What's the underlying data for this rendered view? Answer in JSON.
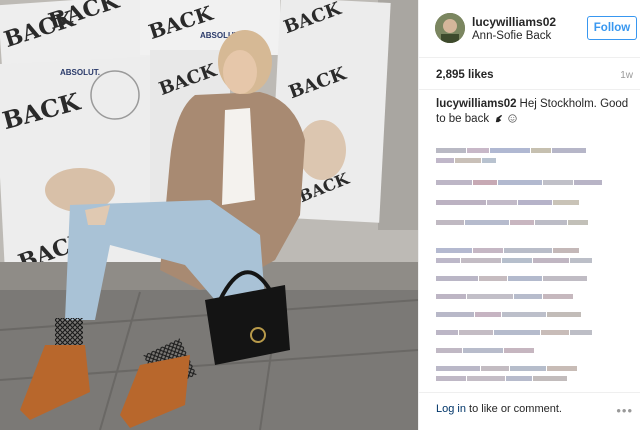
{
  "photo": {
    "poster_word": "BACK",
    "poster_brand": "ABSOLUT."
  },
  "post": {
    "username": "lucywilliams02",
    "location": "Ann-Sofie Back",
    "follow_label": "Follow",
    "likes": "2,895 likes",
    "time": "1w",
    "caption_user": "lucywilliams02",
    "caption_text": "Hej Stockholm. Good to be back"
  },
  "footer": {
    "login_link": "Log in",
    "login_text": " to like or comment.",
    "more_icon": "ellipsis-icon"
  },
  "colors": {
    "accent": "#3897f0",
    "link": "#003569",
    "text": "#262626",
    "muted": "#999999"
  }
}
